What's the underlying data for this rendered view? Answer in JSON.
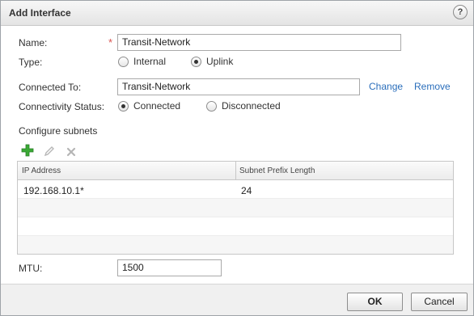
{
  "dialog": {
    "title": "Add Interface",
    "help_label": "?"
  },
  "form": {
    "name_label": "Name:",
    "required_mark": "*",
    "name_value": "Transit-Network",
    "type_label": "Type:",
    "type_options": [
      {
        "label": "Internal",
        "selected": false
      },
      {
        "label": "Uplink",
        "selected": true
      }
    ],
    "connected_to_label": "Connected To:",
    "connected_to_value": "Transit-Network",
    "change_link": "Change",
    "remove_link": "Remove",
    "connectivity_label": "Connectivity Status:",
    "connectivity_options": [
      {
        "label": "Connected",
        "selected": true
      },
      {
        "label": "Disconnected",
        "selected": false
      }
    ],
    "configure_subnets_label": "Configure subnets",
    "mtu_label": "MTU:",
    "mtu_value": "1500"
  },
  "toolbar": {
    "icons": [
      "add-icon",
      "edit-icon",
      "delete-icon"
    ]
  },
  "subnets": {
    "columns": [
      "IP Address",
      "Subnet Prefix Length"
    ],
    "rows": [
      [
        "192.168.10.1*",
        "24"
      ]
    ]
  },
  "footer": {
    "ok_label": "OK",
    "cancel_label": "Cancel"
  },
  "colors": {
    "link": "#2a6ebb",
    "add_icon": "#3aa935",
    "required": "#d9534f"
  }
}
